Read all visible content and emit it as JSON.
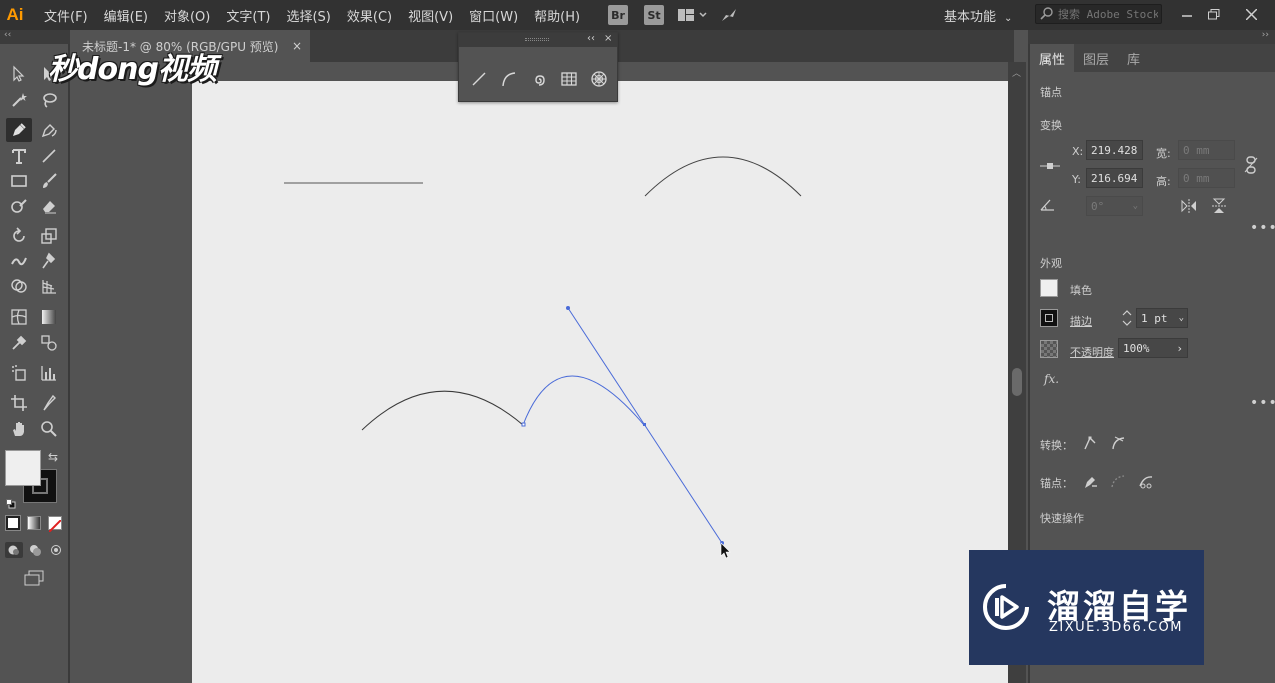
{
  "app": {
    "logo": "Ai"
  },
  "menu": [
    "文件(F)",
    "编辑(E)",
    "对象(O)",
    "文字(T)",
    "选择(S)",
    "效果(C)",
    "视图(V)",
    "窗口(W)",
    "帮助(H)"
  ],
  "toolbar": {
    "bridge_label": "Br",
    "stock_label": "St"
  },
  "workspace": {
    "label": "基本功能"
  },
  "search": {
    "placeholder": "搜索 Adobe Stock"
  },
  "document": {
    "tab_title": "未标题-1* @ 80% (RGB/GPU 预览)",
    "close": "×"
  },
  "floating_panel": {
    "collapse": "‹‹",
    "close": "×"
  },
  "watermark_top": {
    "text": "秒dong视频"
  },
  "panel": {
    "tabs": [
      "属性",
      "图层",
      "库"
    ],
    "anchor_heading": "锚点",
    "transform": {
      "heading": "变换",
      "x_label": "X:",
      "x_value": "219.428",
      "y_label": "Y:",
      "y_value": "216.694",
      "w_label": "宽:",
      "w_value": "0 mm",
      "h_label": "高:",
      "h_value": "0 mm",
      "angle_value": "0°"
    },
    "appearance": {
      "heading": "外观",
      "fill_label": "填色",
      "stroke_label": "描边",
      "stroke_value": "1 pt",
      "opacity_label": "不透明度",
      "opacity_value": "100%",
      "fx_label": "fx."
    },
    "convert_label": "转换：",
    "anchor_label": "锚点：",
    "quick_actions": "快速操作"
  },
  "watermark_box": {
    "brand": "溜溜自学",
    "url": "ZIXUE.3D66.COM"
  },
  "colors": {
    "path_black": "#3a3a3a",
    "selection_blue": "#4a6bd8",
    "artboard": "#ececec",
    "logo_orange": "#ff9a00",
    "watermark_bg": "#25375f"
  }
}
